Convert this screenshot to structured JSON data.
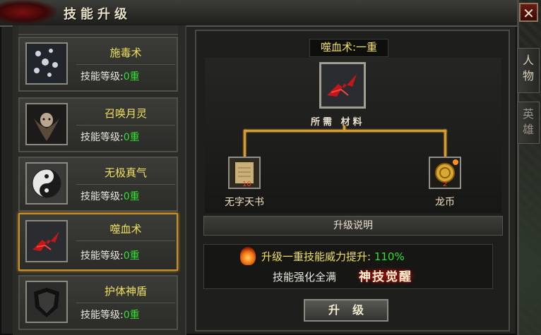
{
  "window": {
    "title": "技能升级",
    "close_label": "✕"
  },
  "side_tabs": [
    {
      "label": "人物"
    },
    {
      "label": "英雄"
    }
  ],
  "skills": [
    {
      "name": "施毒术",
      "level_label": "技能等级:",
      "level_value": "0重",
      "icon": "poison-skill-icon",
      "selected": false
    },
    {
      "name": "召唤月灵",
      "level_label": "技能等级:",
      "level_value": "0重",
      "icon": "moon-spirit-skill-icon",
      "selected": false
    },
    {
      "name": "无极真气",
      "level_label": "技能等级:",
      "level_value": "0重",
      "icon": "yin-yang-skill-icon",
      "selected": false
    },
    {
      "name": "噬血术",
      "level_label": "技能等级:",
      "level_value": "0重",
      "icon": "blood-skill-icon",
      "selected": true
    },
    {
      "name": "护体神盾",
      "level_label": "技能等级:",
      "level_value": "0重",
      "icon": "shield-skill-icon",
      "selected": false
    }
  ],
  "detail": {
    "skill_title": "噬血术:一重",
    "requirement_label": "所需 材料",
    "materials": [
      {
        "name": "无字天书",
        "count": "10",
        "icon": "scroll-book-icon"
      },
      {
        "name": "龙币",
        "count": "2",
        "icon": "dragon-coin-icon"
      }
    ],
    "upgrade_header": "升级说明",
    "desc_prefix": "升级一重技能威力提升: ",
    "desc_value": "110%",
    "desc_line2": "技能强化全满",
    "awaken_text": "神技觉醒",
    "upgrade_button": "升级"
  },
  "colors": {
    "accent_gold": "#c8902a",
    "level_green": "#30e030",
    "name_yellow": "#f0e060"
  }
}
